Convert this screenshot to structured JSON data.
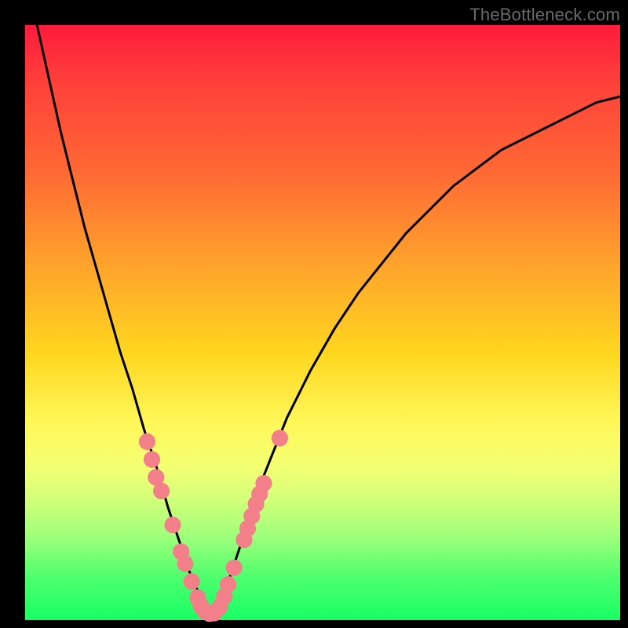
{
  "watermark": "TheBottleneck.com",
  "colors": {
    "frame": "#000000",
    "marker_fill": "#f27f8a",
    "curve_stroke": "#000000",
    "gradient_top": "#ff1a3c",
    "gradient_mid": "#fff85a",
    "gradient_bottom": "#18ff64"
  },
  "chart_data": {
    "type": "line",
    "title": "",
    "xlabel": "",
    "ylabel": "",
    "xlim": [
      0,
      100
    ],
    "ylim": [
      0,
      100
    ],
    "x": [
      0,
      2,
      4,
      6,
      8,
      10,
      12,
      14,
      16,
      18,
      20,
      22,
      24,
      26,
      28,
      30,
      31,
      32,
      34,
      36,
      38,
      40,
      44,
      48,
      52,
      56,
      60,
      64,
      68,
      72,
      76,
      80,
      84,
      88,
      92,
      96,
      100
    ],
    "y": [
      110,
      100,
      91,
      82,
      74,
      66,
      59,
      52,
      45,
      39,
      32,
      26,
      19,
      13,
      7,
      3,
      1,
      2,
      6,
      12,
      18,
      24,
      34,
      42,
      49,
      55,
      60,
      65,
      69,
      73,
      76,
      79,
      81,
      83,
      85,
      87,
      88
    ],
    "markers": [
      {
        "x": 20.5,
        "y": 30
      },
      {
        "x": 21.3,
        "y": 27
      },
      {
        "x": 22.0,
        "y": 24
      },
      {
        "x": 22.9,
        "y": 21.7
      },
      {
        "x": 24.8,
        "y": 16
      },
      {
        "x": 26.2,
        "y": 11.5
      },
      {
        "x": 26.9,
        "y": 9.5
      },
      {
        "x": 28.0,
        "y": 6.5
      },
      {
        "x": 29.0,
        "y": 3.8
      },
      {
        "x": 29.6,
        "y": 2.3
      },
      {
        "x": 30.2,
        "y": 1.5
      },
      {
        "x": 31.0,
        "y": 1.1
      },
      {
        "x": 31.8,
        "y": 1.2
      },
      {
        "x": 32.7,
        "y": 2.2
      },
      {
        "x": 33.5,
        "y": 4.0
      },
      {
        "x": 34.1,
        "y": 6.0
      },
      {
        "x": 35.1,
        "y": 8.8
      },
      {
        "x": 36.8,
        "y": 13.5
      },
      {
        "x": 37.4,
        "y": 15.4
      },
      {
        "x": 38.1,
        "y": 17.5
      },
      {
        "x": 38.8,
        "y": 19.5
      },
      {
        "x": 39.4,
        "y": 21.2
      },
      {
        "x": 40.1,
        "y": 23.0
      },
      {
        "x": 42.8,
        "y": 30.6
      }
    ],
    "marker_radius_logical": 1.4,
    "note": "x and y are in chart logical units (0–100 each). The visible V-shaped curve descends from upper-left to a minimum near x≈31, y≈1, then rises with diminishing slope toward the upper-right. Markers are the pink dots clustered near the bottom of the V."
  }
}
